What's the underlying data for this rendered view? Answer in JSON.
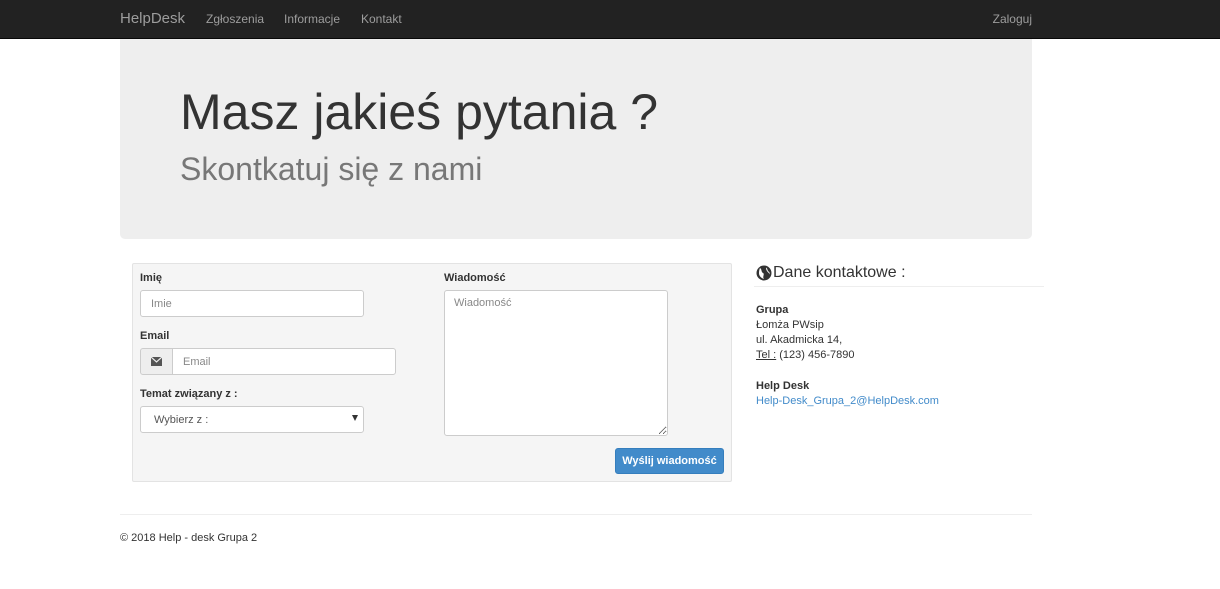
{
  "navbar": {
    "brand": "HelpDesk",
    "links": [
      "Zgłoszenia",
      "Informacje",
      "Kontakt"
    ],
    "login": "Zaloguj"
  },
  "hero": {
    "title": "Masz jakieś pytania ?",
    "subtitle": "Skontkatuj się z nami"
  },
  "form": {
    "name_label": "Imię",
    "name_placeholder": "Imie",
    "email_label": "Email",
    "email_placeholder": "Email",
    "email_icon": "envelope-icon",
    "topic_label": "Temat związany z :",
    "topic_selected": "Wybierz z :",
    "message_label": "Wiadomość",
    "message_placeholder": "Wiadomość",
    "submit_label": "Wyślij wiadomość"
  },
  "contact": {
    "icon": "globe-icon",
    "title": "Dane kontaktowe :",
    "group_name": "Grupa",
    "address_line1": "Łomża PWsip",
    "address_line2": "ul. Akadmicka 14,",
    "phone_abbr": "Tel :",
    "phone": "(123) 456-7890",
    "helpdesk_name": "Help Desk",
    "helpdesk_email": "Help-Desk_Grupa_2@HelpDesk.com"
  },
  "footer": {
    "text": "© 2018 Help - desk Grupa 2"
  },
  "colors": {
    "navbar_bg": "#222222",
    "navbar_text": "#9d9d9d",
    "jumbotron_bg": "#eeeeee",
    "primary": "#428bca",
    "link": "#428bca"
  }
}
